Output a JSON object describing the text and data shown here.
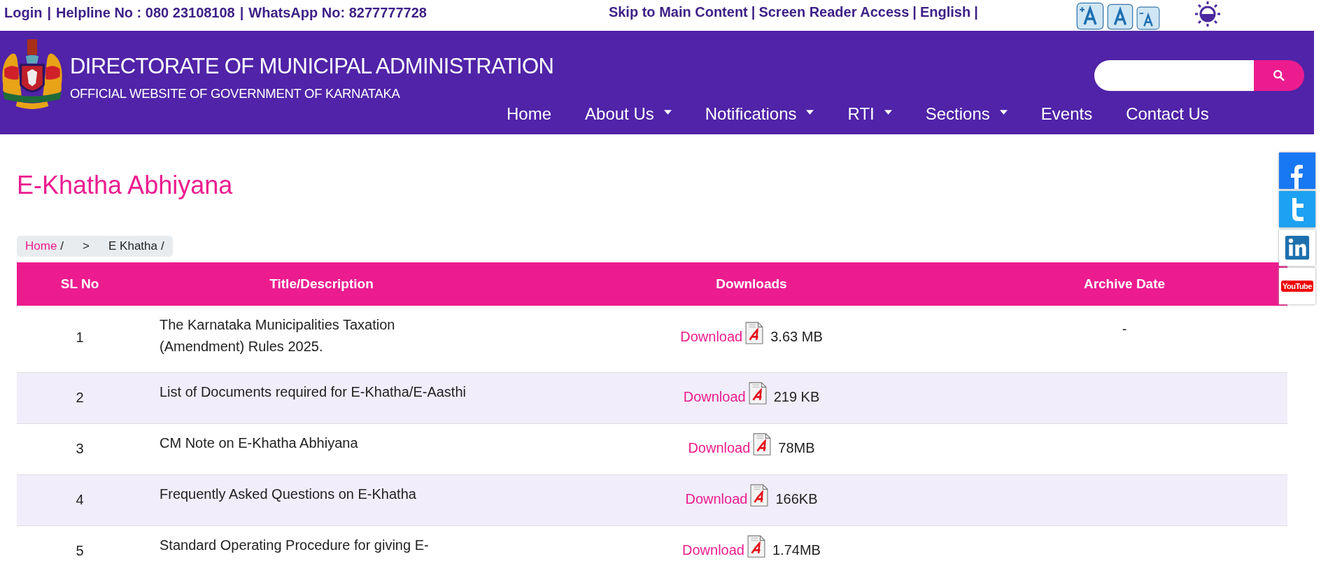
{
  "top_bar": {
    "left_items": [
      {
        "label": "Login",
        "separator": "|"
      },
      {
        "label": "Helpline No : 080 23108108",
        "separator": "|"
      },
      {
        "label": "WhatsApp No: 8277777728"
      }
    ],
    "right_items": [
      {
        "label": "Skip to Main Content",
        "separator": "|"
      },
      {
        "label": "Screen Reader Access",
        "separator": "|"
      },
      {
        "label": "English",
        "separator": "|"
      }
    ],
    "font_buttons": [
      {
        "kind": "increase"
      },
      {
        "kind": "normal"
      },
      {
        "kind": "decrease"
      }
    ]
  },
  "header": {
    "title": "DIRECTORATE OF MUNICIPAL ADMINISTRATION",
    "subtitle": "OFFICIAL WEBSITE OF GOVERNMENT OF KARNATAKA",
    "nav": [
      {
        "label": "Home",
        "dropdown": false
      },
      {
        "label": "About Us",
        "dropdown": true
      },
      {
        "label": "Notifications",
        "dropdown": true
      },
      {
        "label": "RTI",
        "dropdown": true
      },
      {
        "label": "Sections",
        "dropdown": true
      },
      {
        "label": "Events",
        "dropdown": false
      },
      {
        "label": "Contact Us",
        "dropdown": false
      }
    ]
  },
  "page_title": "E-Khatha Abhiyana",
  "breadcrumb": [
    {
      "label": "Home",
      "link": true,
      "separator": "/"
    },
    {
      "label": ">",
      "link": false
    },
    {
      "label": "E Khatha",
      "link": false,
      "separator": "/"
    }
  ],
  "table": {
    "columns": [
      "SL No",
      "Title/Description",
      "Downloads",
      "Archive Date"
    ],
    "rows": [
      {
        "sl": "1",
        "title": "The Karnataka Municipalities Taxation (Amendment)  Rules 2025.",
        "link": "Download",
        "size": "3.63 MB",
        "archive_date": "-"
      },
      {
        "sl": "2",
        "title": "List of Documents required for E-Khatha/E-Aasthi",
        "link": "Download",
        "size": "219 KB"
      },
      {
        "sl": "3",
        "title": "CM Note on E-Khatha Abhiyana",
        "link": "Download",
        "size": "78MB"
      },
      {
        "sl": "4",
        "title": "Frequently Asked Questions on E-Khatha",
        "link": "Download",
        "size": "166KB"
      },
      {
        "sl": "5",
        "title": "Standard Operating Procedure for giving E-",
        "link": "Download",
        "size": "1.74MB"
      }
    ]
  },
  "social": [
    {
      "kind": "facebook"
    },
    {
      "kind": "twitter"
    },
    {
      "kind": "linkedin"
    },
    {
      "kind": "youtube",
      "label": "YouTube"
    }
  ]
}
